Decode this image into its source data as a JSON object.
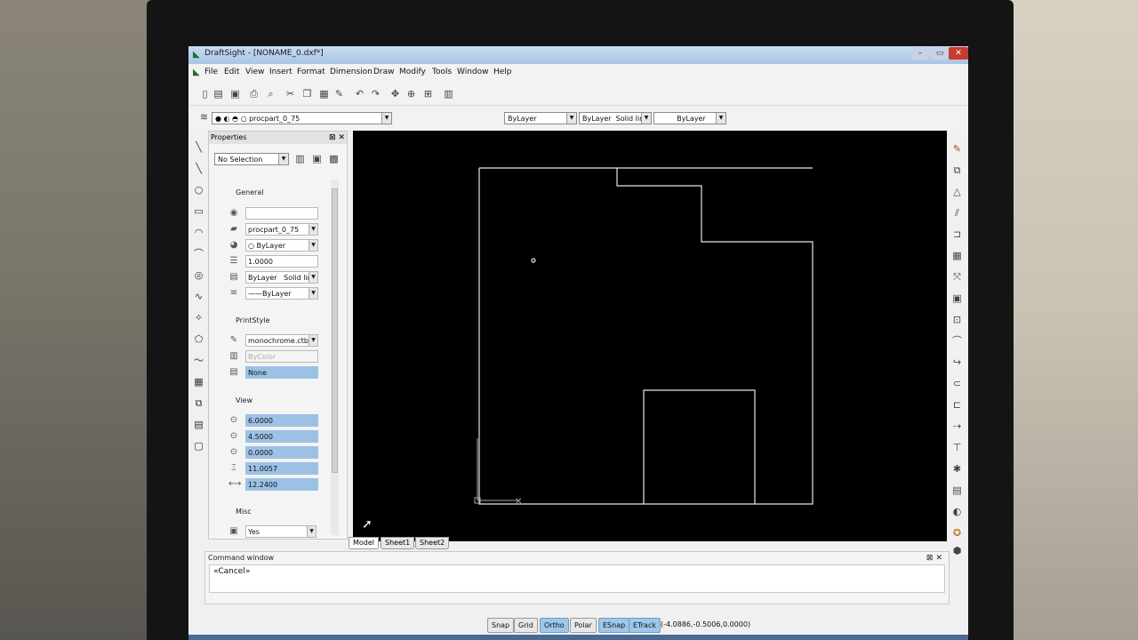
{
  "window": {
    "title": "DraftSight - [NONAME_0.dxf*]"
  },
  "menu": [
    "File",
    "Edit",
    "View",
    "Insert",
    "Format",
    "Dimension",
    "Draw",
    "Modify",
    "Tools",
    "Window",
    "Help"
  ],
  "layer_toolbar": {
    "layer": "procpart_0_75",
    "color": "ByLayer",
    "linestyle_by": "ByLayer",
    "linestyle": "Solid line",
    "lineweight": "ByLayer"
  },
  "properties": {
    "header": "Properties",
    "selection": "No Selection",
    "general_label": "General",
    "general": [
      "",
      "procpart_0_75",
      "ByLayer",
      "1.0000",
      "ByLayer",
      "Solid line",
      "ByLayer"
    ],
    "printstyle_label": "PrintStyle",
    "printstyle": [
      "monochrome.ctb",
      "ByColor",
      "None"
    ],
    "view_label": "View",
    "view": [
      "6.0000",
      "4.5000",
      "0.0000",
      "11.0057",
      "12.2400"
    ],
    "misc_label": "Misc",
    "misc": [
      "Yes"
    ]
  },
  "tabs": [
    "Model",
    "Sheet1",
    "Sheet2"
  ],
  "command": {
    "header": "Command window",
    "text": "«Cancel»"
  },
  "status": {
    "buttons": [
      {
        "label": "Snap",
        "on": false
      },
      {
        "label": "Grid",
        "on": false
      },
      {
        "label": "Ortho",
        "on": true
      },
      {
        "label": "Polar",
        "on": false
      },
      {
        "label": "ESnap",
        "on": true
      },
      {
        "label": "ETrack",
        "on": true
      }
    ],
    "coords": "(-4.0886,-0.5006,0.0000)"
  },
  "colors": {
    "canvas": "#000000",
    "selected": "#9bc2e6",
    "titlebar": "#b5cde9"
  }
}
